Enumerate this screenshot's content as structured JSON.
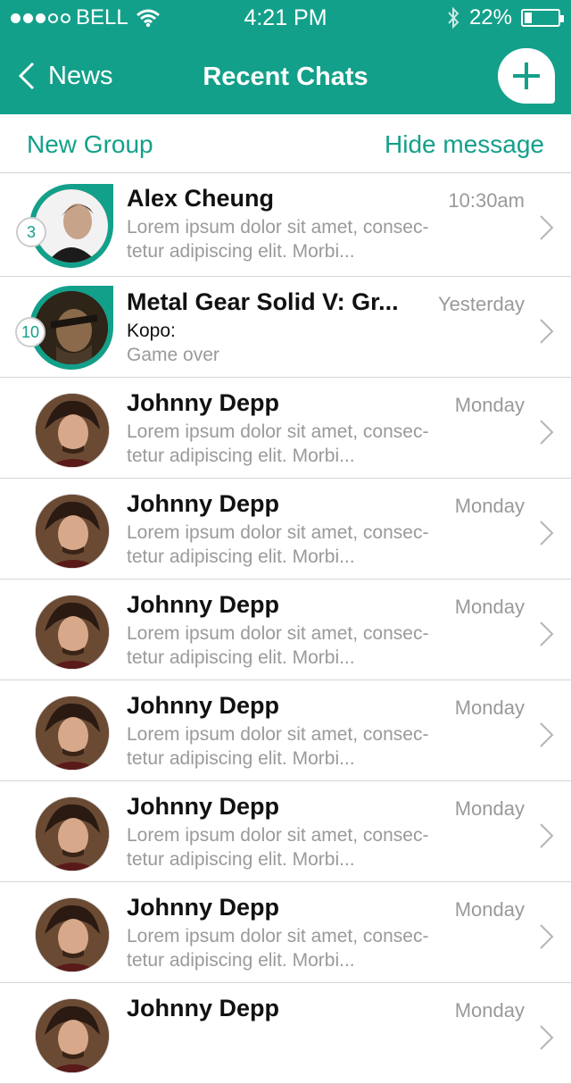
{
  "status": {
    "carrier": "BELL",
    "time": "4:21 PM",
    "battery": "22%",
    "battery_level": 0.22
  },
  "nav": {
    "back_label": "News",
    "title": "Recent Chats",
    "add_icon": "plus-icon"
  },
  "subbar": {
    "left": "New Group",
    "right": "Hide message"
  },
  "chats": [
    {
      "name": "Alex Cheung",
      "time": "10:30am",
      "line1": "Lorem ipsum dolor sit amet, consec-",
      "line2": "tetur adipiscing elit. Morbi...",
      "badge": "3"
    },
    {
      "name": "Metal Gear Solid V: Gr...",
      "time": "Yesterday",
      "sender": "Kopo:",
      "line2": "Game over",
      "badge": "10"
    },
    {
      "name": "Johnny Depp",
      "time": "Monday",
      "line1": "Lorem ipsum dolor sit amet, consec-",
      "line2": "tetur adipiscing elit. Morbi..."
    },
    {
      "name": "Johnny Depp",
      "time": "Monday",
      "line1": "Lorem ipsum dolor sit amet, consec-",
      "line2": "tetur adipiscing elit. Morbi..."
    },
    {
      "name": "Johnny Depp",
      "time": "Monday",
      "line1": "Lorem ipsum dolor sit amet, consec-",
      "line2": "tetur adipiscing elit. Morbi..."
    },
    {
      "name": "Johnny Depp",
      "time": "Monday",
      "line1": "Lorem ipsum dolor sit amet, consec-",
      "line2": "tetur adipiscing elit. Morbi..."
    },
    {
      "name": "Johnny Depp",
      "time": "Monday",
      "line1": "Lorem ipsum dolor sit amet, consec-",
      "line2": "tetur adipiscing elit. Morbi..."
    },
    {
      "name": "Johnny Depp",
      "time": "Monday",
      "line1": "Lorem ipsum dolor sit amet, consec-",
      "line2": "tetur adipiscing elit. Morbi..."
    },
    {
      "name": "Johnny Depp",
      "time": "Monday"
    }
  ],
  "colors": {
    "accent": "#13a08a",
    "muted": "#9a9a9a"
  }
}
